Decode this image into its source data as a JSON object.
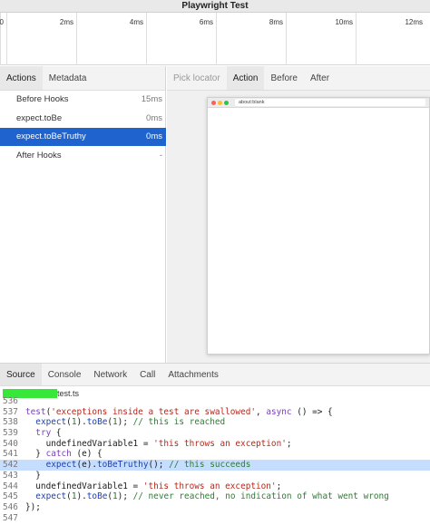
{
  "window": {
    "title": "Playwright Test"
  },
  "timeline": {
    "ticks": [
      "0",
      "2ms",
      "4ms",
      "6ms",
      "8ms",
      "10ms",
      "12ms"
    ]
  },
  "actions_panel": {
    "tabs": [
      "Actions",
      "Metadata"
    ],
    "items": [
      {
        "title": "Before Hooks",
        "time": "15ms",
        "selected": false
      },
      {
        "title": "expect.toBe",
        "time": "0ms",
        "selected": false
      },
      {
        "title": "expect.toBeTruthy",
        "time": "0ms",
        "selected": true
      },
      {
        "title": "After Hooks",
        "time": "-",
        "selected": false
      }
    ]
  },
  "snapshot_panel": {
    "pick_locator": "Pick locator",
    "tabs": [
      "Action",
      "Before",
      "After"
    ],
    "browser_url": "about:blank",
    "dot_colors": [
      "#ff5f57",
      "#febc2e",
      "#28c840"
    ]
  },
  "bottom_panel": {
    "tabs": [
      "Source",
      "Console",
      "Network",
      "Call",
      "Attachments"
    ],
    "file_name": "test.ts",
    "code_lines": [
      {
        "num": "536",
        "text": ""
      },
      {
        "num": "537",
        "text": "test('exceptions inside a test are swallowed', async () => {"
      },
      {
        "num": "538",
        "text": "  expect(1).toBe(1); // this is reached"
      },
      {
        "num": "539",
        "text": "  try {"
      },
      {
        "num": "540",
        "text": "    undefinedVariable1 = 'this throws an exception';"
      },
      {
        "num": "541",
        "text": "  } catch (e) {"
      },
      {
        "num": "542",
        "text": "    expect(e).toBeTruthy(); // this succeeds",
        "highlight": true
      },
      {
        "num": "543",
        "text": "  }"
      },
      {
        "num": "544",
        "text": "  undefinedVariable1 = 'this throws an exception';"
      },
      {
        "num": "545",
        "text": "  expect(1).toBe(1); // never reached, no indication of what went wrong"
      },
      {
        "num": "546",
        "text": "});"
      },
      {
        "num": "547",
        "text": ""
      }
    ]
  }
}
